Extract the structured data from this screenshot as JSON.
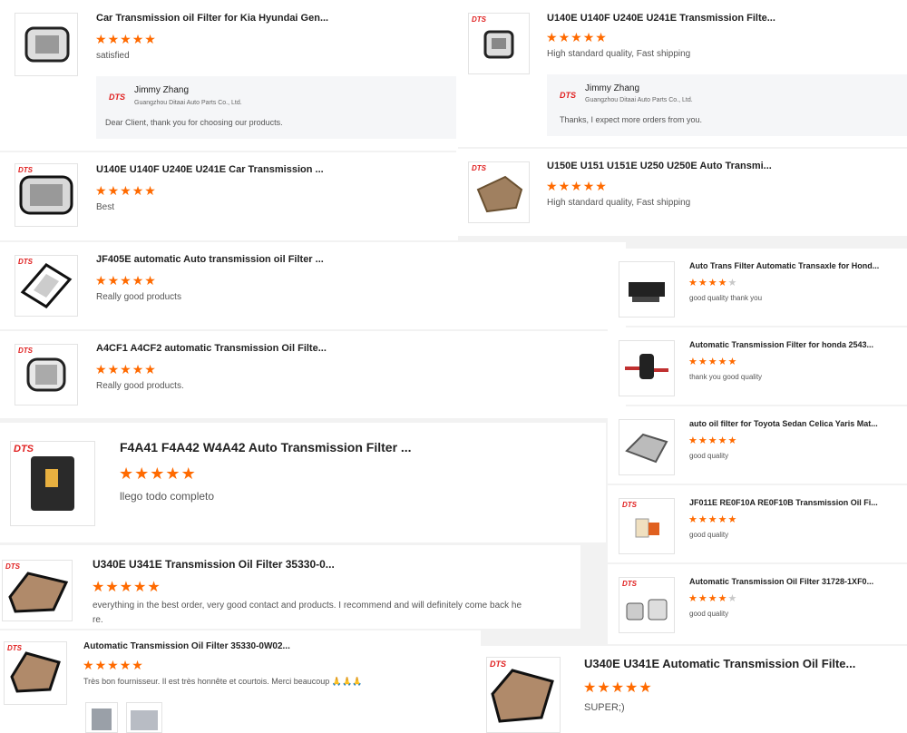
{
  "brand": "DTS",
  "accent": "#ff6a00",
  "reviews": [
    {
      "title": "Car Transmission oil Filter for Kia Hyundai Gen...",
      "rating": 5,
      "comment": "satisfied",
      "reply": {
        "name": "Jimmy Zhang",
        "company": "Guangzhou Ditaai Auto Parts Co., Ltd.",
        "message": "Dear Client, thank you for choosing our products."
      }
    },
    {
      "title": "U140E U140F U240E U241E Transmission Filte...",
      "rating": 5,
      "comment": "High standard quality, Fast shipping",
      "reply": {
        "name": "Jimmy Zhang",
        "company": "Guangzhou Ditaai Auto Parts Co., Ltd.",
        "message": "Thanks, I expect more orders from you."
      }
    },
    {
      "title": "U140E U140F U240E U241E Car Transmission ...",
      "rating": 5,
      "comment": "Best"
    },
    {
      "title": "U150E U151 U151E U250 U250E Auto Transmi...",
      "rating": 5,
      "comment": "High standard quality, Fast shipping"
    },
    {
      "title": "JF405E automatic Auto transmission oil Filter ...",
      "rating": 5,
      "comment": "Really good products"
    },
    {
      "title": "A4CF1 A4CF2 automatic Transmission Oil Filte...",
      "rating": 5,
      "comment": "Really good products."
    },
    {
      "title": "Auto Trans Filter Automatic Transaxle for Hond...",
      "rating": 4,
      "comment": "good quality thank you"
    },
    {
      "title": "Automatic Transmission Filter for honda 2543...",
      "rating": 5,
      "comment": "thank you good quality"
    },
    {
      "title": "auto oil filter for Toyota Sedan Celica Yaris Mat...",
      "rating": 5,
      "comment": "good quality"
    },
    {
      "title": "JF011E RE0F10A RE0F10B Transmission Oil Fi...",
      "rating": 5,
      "comment": "good quality"
    },
    {
      "title": "Automatic Transmission Oil Filter 31728-1XF0...",
      "rating": 4,
      "comment": "good quality"
    },
    {
      "title": "F4A41 F4A42 W4A42 Auto Transmission Filter ...",
      "rating": 5,
      "comment": "llego todo completo"
    },
    {
      "title": "U340E U341E Transmission Oil Filter 35330-0...",
      "rating": 5,
      "comment": "everything in the best order, very good contact and products. I recommend and will definitely come back he",
      "comment2": "re."
    },
    {
      "title": "Automatic Transmission Oil Filter 35330-0W02...",
      "rating": 5,
      "comment": "Très bon fournisseur. Il est très honnête et courtois. Merci beaucoup 🙏🙏🙏"
    },
    {
      "title": "U340E U341E Automatic Transmission Oil Filte...",
      "rating": 5,
      "comment": "SUPER;)"
    }
  ]
}
